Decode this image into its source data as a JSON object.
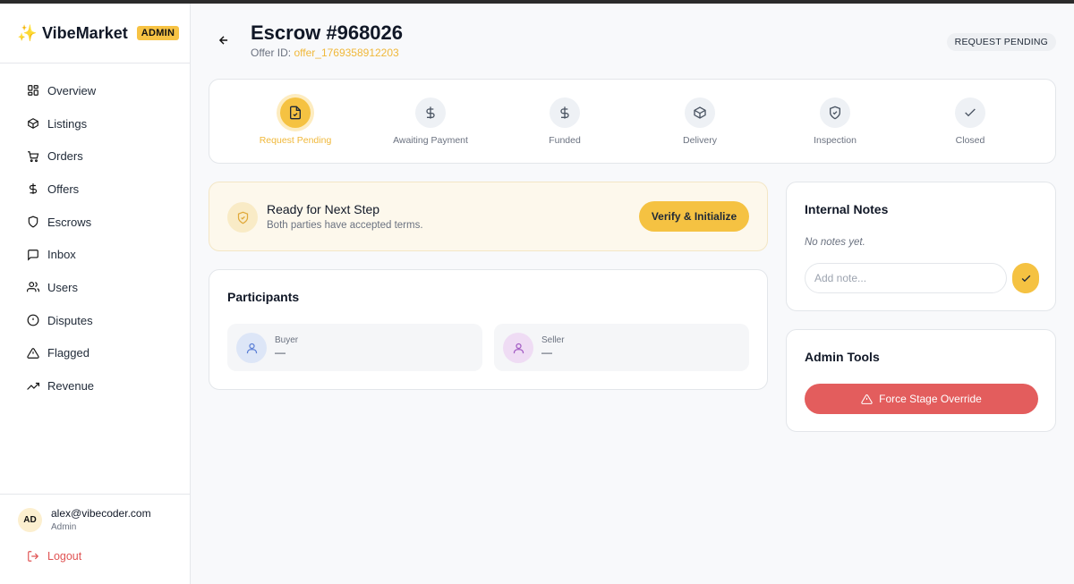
{
  "brand": {
    "name": "VibeMarket",
    "badge": "ADMIN"
  },
  "sidebar": {
    "items": [
      {
        "label": "Overview",
        "icon": "grid-icon"
      },
      {
        "label": "Listings",
        "icon": "box-icon"
      },
      {
        "label": "Orders",
        "icon": "cart-icon"
      },
      {
        "label": "Offers",
        "icon": "dollar-icon"
      },
      {
        "label": "Escrows",
        "icon": "shield-icon"
      },
      {
        "label": "Inbox",
        "icon": "message-icon"
      },
      {
        "label": "Users",
        "icon": "users-icon"
      },
      {
        "label": "Disputes",
        "icon": "alert-circle-icon"
      },
      {
        "label": "Flagged",
        "icon": "warning-triangle-icon"
      },
      {
        "label": "Revenue",
        "icon": "trending-up-icon"
      }
    ]
  },
  "user": {
    "initials": "AD",
    "email": "alex@vibecoder.com",
    "role": "Admin",
    "logout_label": "Logout"
  },
  "header": {
    "title": "Escrow #968026",
    "offer_label": "Offer ID:",
    "offer_id": "offer_1769358912203",
    "status": "REQUEST PENDING"
  },
  "steps": [
    {
      "label": "Request Pending",
      "icon": "file-check-icon",
      "active": true
    },
    {
      "label": "Awaiting Payment",
      "icon": "dollar-icon",
      "active": false
    },
    {
      "label": "Funded",
      "icon": "dollar-icon",
      "active": false
    },
    {
      "label": "Delivery",
      "icon": "box-icon",
      "active": false
    },
    {
      "label": "Inspection",
      "icon": "shield-check-icon",
      "active": false
    },
    {
      "label": "Closed",
      "icon": "check-icon",
      "active": false
    }
  ],
  "ready": {
    "title": "Ready for Next Step",
    "subtitle": "Both parties have accepted terms.",
    "button": "Verify & Initialize"
  },
  "participants": {
    "title": "Participants",
    "buyer": {
      "role": "Buyer",
      "value": "—"
    },
    "seller": {
      "role": "Seller",
      "value": "—"
    }
  },
  "notes": {
    "title": "Internal Notes",
    "empty": "No notes yet.",
    "placeholder": "Add note..."
  },
  "admin_tools": {
    "title": "Admin Tools",
    "button": "Force Stage Override"
  },
  "colors": {
    "accent": "#f5c242",
    "danger": "#e35d5d",
    "accent_text": "#f0b83a"
  }
}
